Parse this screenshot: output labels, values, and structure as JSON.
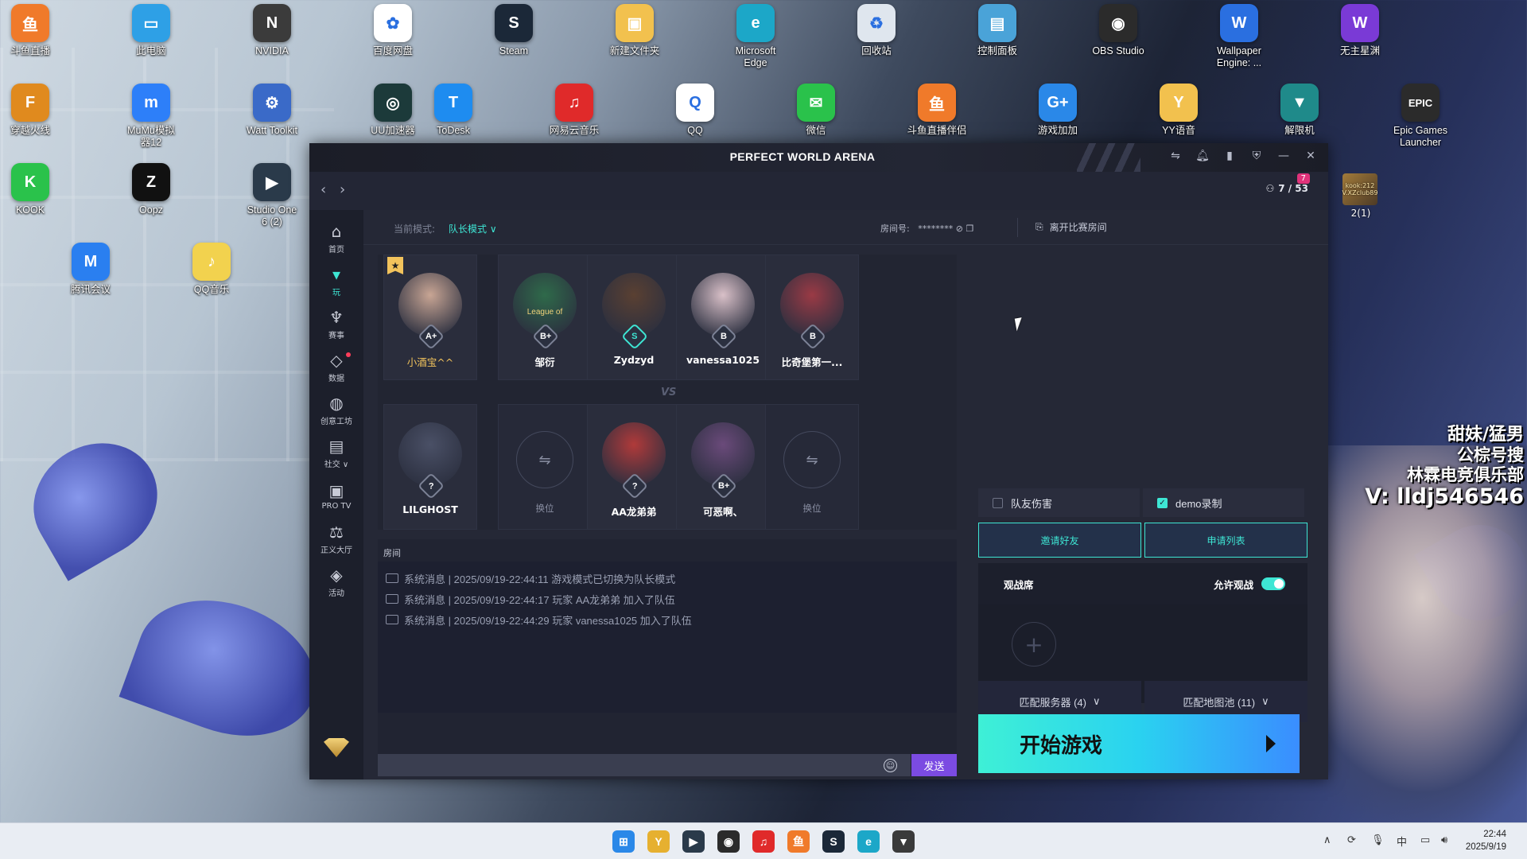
{
  "desktop": {
    "icons": [
      {
        "label": "斗鱼直播",
        "glyph": "鱼",
        "color": "#f07a2a",
        "col": 0,
        "row": 0
      },
      {
        "label": "此电脑",
        "glyph": "▭",
        "color": "#2ea0e6",
        "col": 1,
        "row": 0
      },
      {
        "label": "NVIDIA",
        "glyph": "N",
        "color": "#3b3b3b",
        "col": 2,
        "row": 0
      },
      {
        "label": "百度网盘",
        "glyph": "✿",
        "color": "#ffffff",
        "col": 3,
        "row": 0
      },
      {
        "label": "Steam",
        "glyph": "S",
        "color": "#1b2838",
        "col": 4,
        "row": 0
      },
      {
        "label": "新建文件夹",
        "glyph": "▣",
        "color": "#f2c14e",
        "col": 5,
        "row": 0
      },
      {
        "label": "Microsoft\nEdge",
        "glyph": "e",
        "color": "#1ca7c8",
        "col": 6,
        "row": 0
      },
      {
        "label": "回收站",
        "glyph": "♻",
        "color": "#dfe6ee",
        "col": 7,
        "row": 0
      },
      {
        "label": "控制面板",
        "glyph": "▤",
        "color": "#4aa3d8",
        "col": 8,
        "row": 0
      },
      {
        "label": "OBS Studio",
        "glyph": "◉",
        "color": "#2b2b2b",
        "col": 9,
        "row": 0
      },
      {
        "label": "Wallpaper\nEngine: ...",
        "glyph": "W",
        "color": "#2a6fe0",
        "col": 10,
        "row": 0
      },
      {
        "label": "无主星渊",
        "glyph": "W",
        "color": "#7a3ad6",
        "col": 11,
        "row": 0
      },
      {
        "label": "穿越火线",
        "glyph": "F",
        "color": "#e08a1e",
        "col": 0,
        "row": 1
      },
      {
        "label": "MuMu模拟\n器12",
        "glyph": "m",
        "color": "#2d7ff9",
        "col": 1,
        "row": 1
      },
      {
        "label": "Watt Toolkit",
        "glyph": "⚙",
        "color": "#3a6ac8",
        "col": 2,
        "row": 1
      },
      {
        "label": "UU加速器",
        "glyph": "◎",
        "color": "#1c3a3a",
        "col": 3,
        "row": 1
      },
      {
        "label": "ToDesk",
        "glyph": "T",
        "color": "#1e8cf0",
        "col": 3.5,
        "row": 1
      },
      {
        "label": "网易云音乐",
        "glyph": "♫",
        "color": "#e02a2a",
        "col": 4.5,
        "row": 1
      },
      {
        "label": "QQ",
        "glyph": "Q",
        "color": "#ffffff",
        "col": 5.5,
        "row": 1
      },
      {
        "label": "微信",
        "glyph": "✉",
        "color": "#2ac24b",
        "col": 6.5,
        "row": 1
      },
      {
        "label": "斗鱼直播伴侣",
        "glyph": "鱼",
        "color": "#f07a2a",
        "col": 7.5,
        "row": 1
      },
      {
        "label": "游戏加加",
        "glyph": "G+",
        "color": "#2a88e8",
        "col": 8.5,
        "row": 1
      },
      {
        "label": "YY语音",
        "glyph": "Y",
        "color": "#f2c14e",
        "col": 9.5,
        "row": 1
      },
      {
        "label": "解限机",
        "glyph": "▼",
        "color": "#1f8a8a",
        "col": 10.5,
        "row": 1
      },
      {
        "label": "Epic Games\nLauncher",
        "glyph": "EPIC",
        "color": "#2b2b2b",
        "col": 11.5,
        "row": 1
      },
      {
        "label": "KOOK",
        "glyph": "K",
        "color": "#2ac24b",
        "col": 0,
        "row": 2
      },
      {
        "label": "Oopz",
        "glyph": "Z",
        "color": "#111111",
        "col": 1,
        "row": 2
      },
      {
        "label": "Studio One\n6 (2)",
        "glyph": "▶",
        "color": "#2a3a4a",
        "col": 2,
        "row": 2
      },
      {
        "label": "腾讯会议",
        "glyph": "M",
        "color": "#2a7ff0",
        "col": 0.5,
        "row": 3
      },
      {
        "label": "QQ音乐",
        "glyph": "♪",
        "color": "#f2d24e",
        "col": 1.5,
        "row": 3
      }
    ]
  },
  "app": {
    "title": "PERFECT WORLD ARENA",
    "online_count": "7 / 53",
    "online_badge": "7",
    "sidebar": [
      {
        "label": "首页",
        "icon": "⌂",
        "name": "home",
        "active": false
      },
      {
        "label": "玩",
        "icon": "▾",
        "name": "play",
        "active": true
      },
      {
        "label": "赛事",
        "icon": "♆",
        "name": "events",
        "active": false
      },
      {
        "label": "数据",
        "icon": "◇",
        "name": "data",
        "active": false,
        "dot": true
      },
      {
        "label": "创意工坊",
        "icon": "◍",
        "name": "workshop",
        "active": false
      },
      {
        "label": "社交 ∨",
        "icon": "▤",
        "name": "social",
        "active": false
      },
      {
        "label": "PRO TV",
        "icon": "▣",
        "name": "pro-tv",
        "active": false
      },
      {
        "label": "正义大厅",
        "icon": "⚖",
        "name": "justice-hall",
        "active": false
      },
      {
        "label": "活动",
        "icon": "◈",
        "name": "activities",
        "active": false
      }
    ],
    "toolbar": {
      "mode_label": "当前模式:",
      "mode_value": "队长模式",
      "room_label": "房间号:",
      "room_value": "********",
      "leave_label": "离开比赛房间"
    },
    "team_top": [
      {
        "name": "小酒宝^^",
        "rank": "A+",
        "color": "#c8a594",
        "gold": true,
        "captain": true
      },
      {
        "name": "邹衍",
        "rank": "B+",
        "color": "#2f6a4a",
        "gold": false,
        "captain": false,
        "avatar_text": "League of"
      },
      {
        "name": "Zydzyd",
        "rank": "S",
        "color": "#5a4032",
        "gold": false,
        "captain": false
      },
      {
        "name": "vanessa1025",
        "rank": "B",
        "color": "#d9c0c8",
        "gold": false,
        "captain": false
      },
      {
        "name": "比奇堡第一...",
        "rank": "B",
        "color": "#9a3a45",
        "gold": false,
        "captain": false
      }
    ],
    "team_bottom": [
      {
        "name": "LILGHOST",
        "rank": "?",
        "color": "#4a5066",
        "empty": false
      },
      {
        "name": "换位",
        "empty": true
      },
      {
        "name": "AA龙弟弟",
        "rank": "?",
        "color": "#b03a3a",
        "empty": false
      },
      {
        "name": "可恶啊、",
        "rank": "B+",
        "color": "#6a4a7a",
        "empty": false
      },
      {
        "name": "换位",
        "empty": true
      }
    ],
    "vs_text": "VS",
    "chat": {
      "title": "房间",
      "messages": [
        "系统消息 | 2025/09/19-22:44:11 游戏模式已切换为队长模式",
        "系统消息 | 2025/09/19-22:44:17 玩家 AA龙弟弟 加入了队伍",
        "系统消息 | 2025/09/19-22:44:29 玩家 vanessa1025 加入了队伍"
      ],
      "send_label": "发送"
    },
    "options": {
      "friendly_fire": "队友伤害",
      "demo_record": "demo录制"
    },
    "invite_label": "邀请好友",
    "apply_label": "申请列表",
    "spectate": {
      "title": "观战席",
      "allow_label": "允许观战"
    },
    "match_server": "匹配服务器 (4)",
    "match_maps": "匹配地图池 (11)",
    "start_label": "开始游戏"
  },
  "overlay": {
    "line1": "甜妹/猛男",
    "line2": "公棕号搜",
    "line3": "林霖电竞俱乐部",
    "line4": "V:  lldj546546",
    "widget_text": "kook:212\nV.XZclub89",
    "widget_count": "2(1)"
  },
  "taskbar": {
    "apps": [
      {
        "name": "start",
        "glyph": "⊞",
        "color": "#2a88e8"
      },
      {
        "name": "yy",
        "glyph": "Y",
        "color": "#e6b030"
      },
      {
        "name": "studio-one",
        "glyph": "▶",
        "color": "#2a3a4a"
      },
      {
        "name": "obs",
        "glyph": "◉",
        "color": "#2b2b2b"
      },
      {
        "name": "netease-music",
        "glyph": "♫",
        "color": "#e02a2a"
      },
      {
        "name": "douyu",
        "glyph": "鱼",
        "color": "#f07a2a"
      },
      {
        "name": "steam",
        "glyph": "S",
        "color": "#1b2838"
      },
      {
        "name": "edge",
        "glyph": "e",
        "color": "#1ca7c8"
      },
      {
        "name": "perfect-world",
        "glyph": "▼",
        "color": "#3a3a3a"
      }
    ],
    "ime": "中",
    "time": "22:44",
    "date": "2025/9/19"
  }
}
